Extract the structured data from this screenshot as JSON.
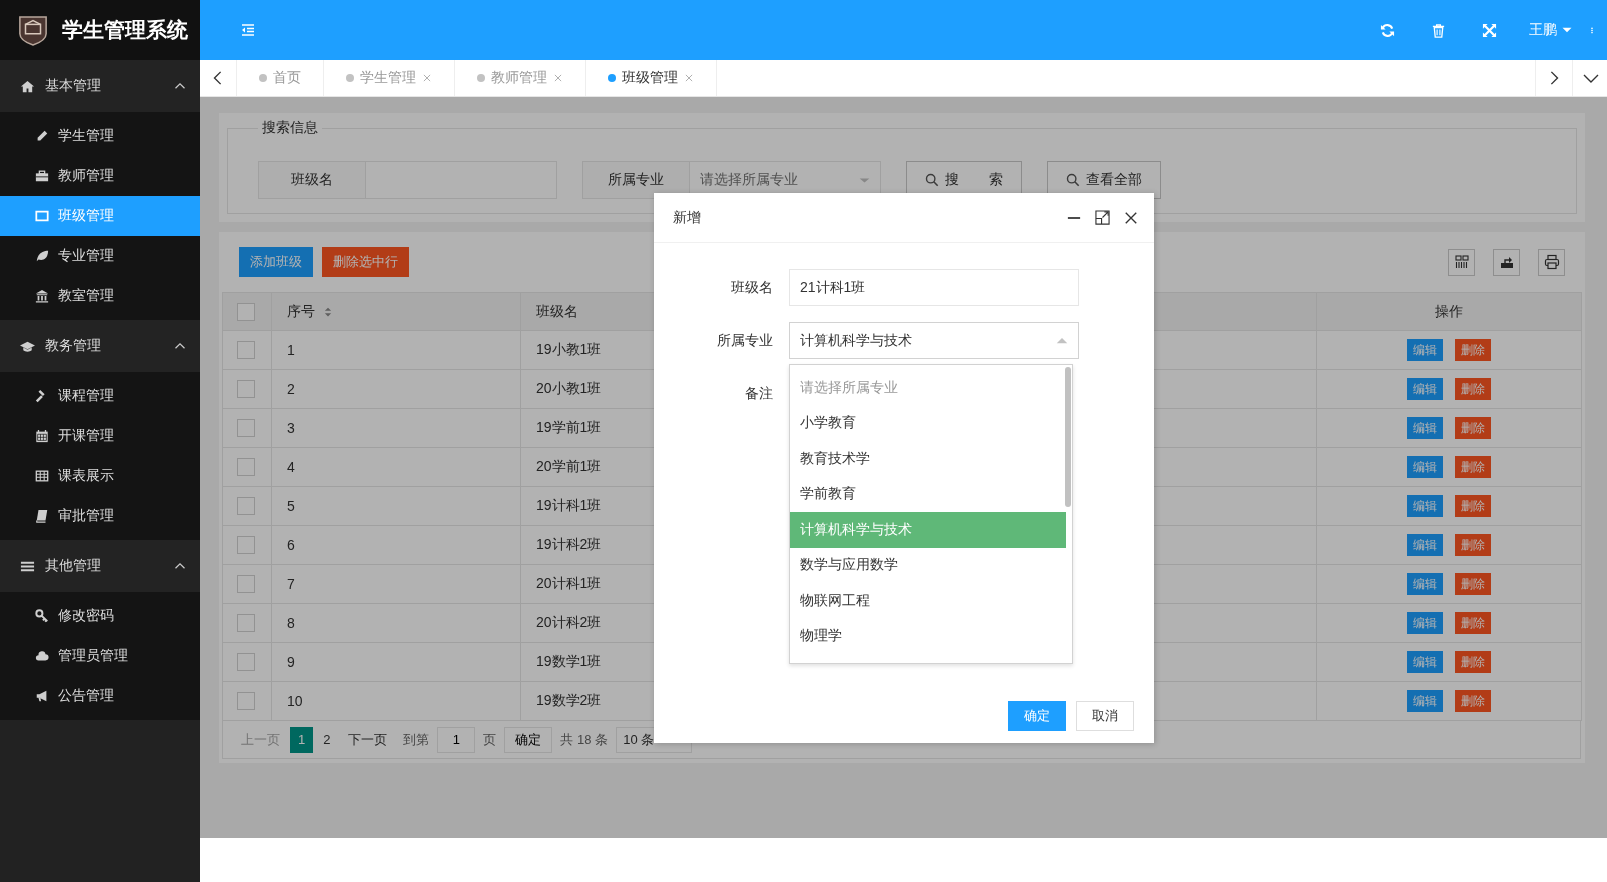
{
  "app": {
    "title": "学生管理系统"
  },
  "header": {
    "user": "王鹏"
  },
  "sidebar": {
    "groups": [
      {
        "label": "基本管理",
        "expanded": true,
        "items": [
          {
            "label": "学生管理",
            "selected": false
          },
          {
            "label": "教师管理",
            "selected": false
          },
          {
            "label": "班级管理",
            "selected": true
          },
          {
            "label": "专业管理",
            "selected": false
          },
          {
            "label": "教室管理",
            "selected": false
          }
        ]
      },
      {
        "label": "教务管理",
        "expanded": true,
        "items": [
          {
            "label": "课程管理",
            "selected": false
          },
          {
            "label": "开课管理",
            "selected": false
          },
          {
            "label": "课表展示",
            "selected": false
          },
          {
            "label": "审批管理",
            "selected": false
          }
        ]
      },
      {
        "label": "其他管理",
        "expanded": true,
        "items": [
          {
            "label": "修改密码",
            "selected": false
          },
          {
            "label": "管理员管理",
            "selected": false
          },
          {
            "label": "公告管理",
            "selected": false
          }
        ]
      }
    ]
  },
  "tabs": [
    {
      "label": "首页",
      "closable": false,
      "selected": false
    },
    {
      "label": "学生管理",
      "closable": true,
      "selected": false
    },
    {
      "label": "教师管理",
      "closable": true,
      "selected": false
    },
    {
      "label": "班级管理",
      "closable": true,
      "selected": true
    }
  ],
  "search": {
    "legend": "搜索信息",
    "fields": [
      {
        "kind": "text",
        "label": "班级名"
      },
      {
        "kind": "select",
        "label": "所属专业",
        "placeholder": "请选择所属专业"
      }
    ],
    "buttons": [
      "搜 索",
      "查看全部"
    ]
  },
  "toolbar": {
    "buttons": [
      {
        "label": "添加班级",
        "kind": "primary"
      },
      {
        "label": "删除选中行",
        "kind": "danger"
      }
    ]
  },
  "table": {
    "all_checked": false,
    "columns": [
      {
        "label": "序号",
        "sortable": true
      },
      {
        "label": "班级名",
        "sortable": false
      },
      {},
      {
        "label": "操作",
        "sortable": false
      }
    ],
    "rows": [
      {
        "checked": false,
        "cells": [
          "1",
          "19小教1班"
        ],
        "actions": [
          "编辑",
          "删除"
        ]
      },
      {
        "checked": false,
        "cells": [
          "2",
          "20小教1班"
        ],
        "actions": [
          "编辑",
          "删除"
        ]
      },
      {
        "checked": false,
        "cells": [
          "3",
          "19学前1班"
        ],
        "actions": [
          "编辑",
          "删除"
        ]
      },
      {
        "checked": false,
        "cells": [
          "4",
          "20学前1班"
        ],
        "actions": [
          "编辑",
          "删除"
        ]
      },
      {
        "checked": false,
        "cells": [
          "5",
          "19计科1班"
        ],
        "actions": [
          "编辑",
          "删除"
        ]
      },
      {
        "checked": false,
        "cells": [
          "6",
          "19计科2班"
        ],
        "actions": [
          "编辑",
          "删除"
        ]
      },
      {
        "checked": false,
        "cells": [
          "7",
          "20计科1班"
        ],
        "actions": [
          "编辑",
          "删除"
        ]
      },
      {
        "checked": false,
        "cells": [
          "8",
          "20计科2班"
        ],
        "actions": [
          "编辑",
          "删除"
        ]
      },
      {
        "checked": false,
        "cells": [
          "9",
          "19数学1班"
        ],
        "actions": [
          "编辑",
          "删除"
        ]
      },
      {
        "checked": false,
        "cells": [
          "10",
          "19数学2班"
        ],
        "actions": [
          "编辑",
          "删除"
        ]
      }
    ]
  },
  "pagination": {
    "prev": {
      "label": "上一页",
      "disabled": true
    },
    "pages": [
      {
        "label": "1",
        "selected": true
      },
      {
        "label": "2",
        "selected": false
      }
    ],
    "next": {
      "label": "下一页",
      "disabled": false
    },
    "goto_label": "到第",
    "goto_value": "1",
    "page_label": "页",
    "confirm": "确定",
    "total": "共 18 条",
    "page_size": "10 条"
  },
  "dialog": {
    "title": "新增",
    "fields": [
      {
        "kind": "text",
        "label": "班级名",
        "value": "21计科1班"
      },
      {
        "kind": "select",
        "label": "所属专业",
        "value": "计算机科学与技术",
        "expanded": true,
        "options": [
          {
            "label": "请选择所属专业",
            "placeholder": true,
            "selected": false
          },
          {
            "label": "小学教育",
            "placeholder": false,
            "selected": false
          },
          {
            "label": "教育技术学",
            "placeholder": false,
            "selected": false
          },
          {
            "label": "学前教育",
            "placeholder": false,
            "selected": false
          },
          {
            "label": "计算机科学与技术",
            "placeholder": false,
            "selected": true
          },
          {
            "label": "数学与应用数学",
            "placeholder": false,
            "selected": false
          },
          {
            "label": "物联网工程",
            "placeholder": false,
            "selected": false
          },
          {
            "label": "物理学",
            "placeholder": false,
            "selected": false
          }
        ]
      },
      {
        "kind": "textarea",
        "label": "备注"
      }
    ],
    "buttons": [
      {
        "label": "确定",
        "kind": "primary"
      },
      {
        "label": "取消",
        "kind": "default"
      }
    ]
  }
}
